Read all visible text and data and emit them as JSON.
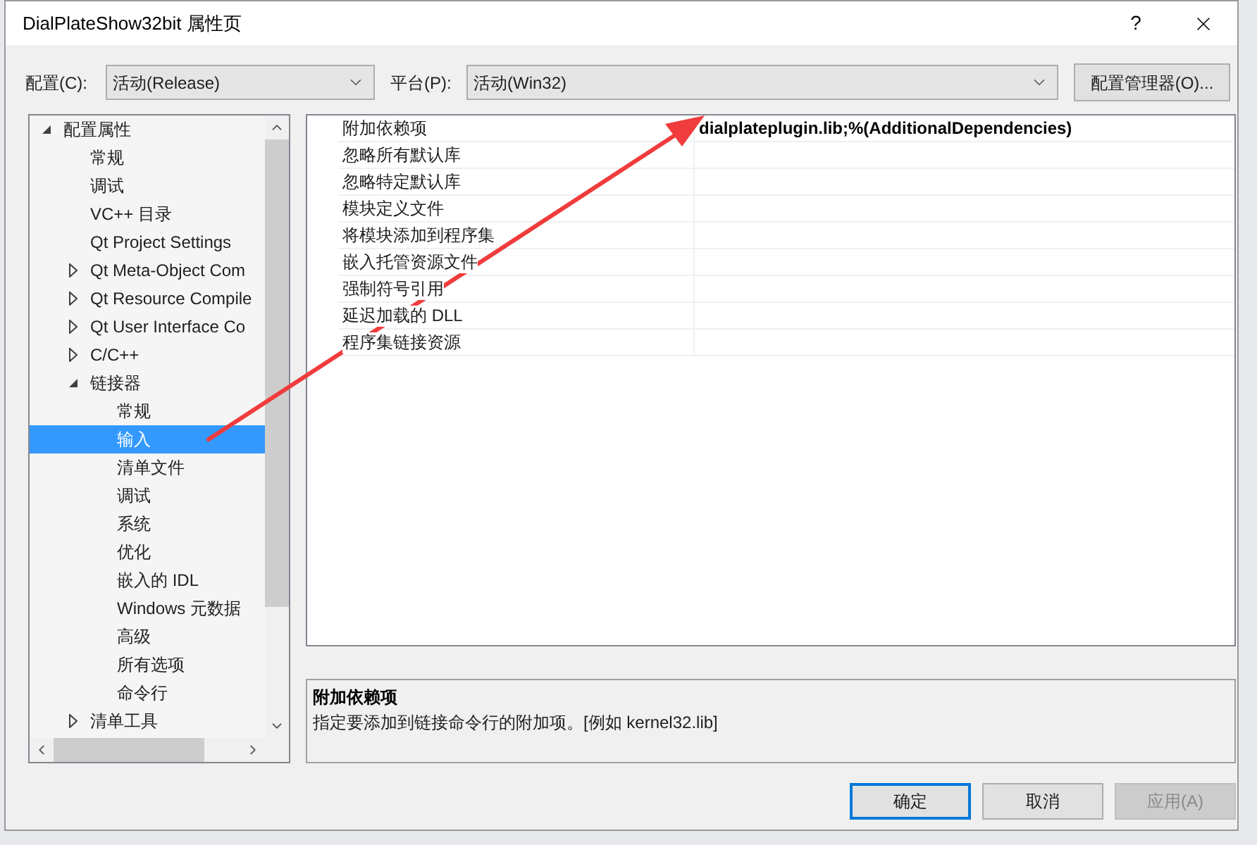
{
  "window": {
    "title": "DialPlateShow32bit 属性页",
    "help": "?"
  },
  "toolbar": {
    "configuration": {
      "label": "配置(C):",
      "value": "活动(Release)"
    },
    "platform": {
      "label": "平台(P):",
      "value": "活动(Win32)"
    },
    "manager_button": "配置管理器(O)..."
  },
  "tree": {
    "items": [
      {
        "label": "配置属性",
        "expanded": true,
        "selected": false,
        "children": [
          {
            "label": "常规",
            "selected": false
          },
          {
            "label": "调试",
            "selected": false
          },
          {
            "label": "VC++ 目录",
            "selected": false
          },
          {
            "label": "Qt Project Settings",
            "selected": false
          },
          {
            "label": "Qt Meta-Object Com",
            "expanded": false,
            "selected": false
          },
          {
            "label": "Qt Resource Compile",
            "expanded": false,
            "selected": false
          },
          {
            "label": "Qt User Interface Co",
            "expanded": false,
            "selected": false
          },
          {
            "label": "C/C++",
            "expanded": false,
            "selected": false
          },
          {
            "label": "链接器",
            "expanded": true,
            "selected": false,
            "children": [
              {
                "label": "常规",
                "selected": false
              },
              {
                "label": "输入",
                "selected": true
              },
              {
                "label": "清单文件",
                "selected": false
              },
              {
                "label": "调试",
                "selected": false
              },
              {
                "label": "系统",
                "selected": false
              },
              {
                "label": "优化",
                "selected": false
              },
              {
                "label": "嵌入的 IDL",
                "selected": false
              },
              {
                "label": "Windows 元数据",
                "selected": false
              },
              {
                "label": "高级",
                "selected": false
              },
              {
                "label": "所有选项",
                "selected": false
              },
              {
                "label": "命令行",
                "selected": false
              }
            ]
          },
          {
            "label": "清单工具",
            "expanded": false,
            "selected": false
          }
        ]
      }
    ]
  },
  "properties": {
    "rows": [
      {
        "name": "附加依赖项",
        "value": "dialplateplugin.lib;%(AdditionalDependencies)"
      },
      {
        "name": "忽略所有默认库"
      },
      {
        "name": "忽略特定默认库"
      },
      {
        "name": "模块定义文件"
      },
      {
        "name": "将模块添加到程序集"
      },
      {
        "name": "嵌入托管资源文件"
      },
      {
        "name": "强制符号引用"
      },
      {
        "name": "延迟加载的 DLL"
      },
      {
        "name": "程序集链接资源"
      }
    ]
  },
  "description": {
    "title": "附加依赖项",
    "text": "指定要添加到链接命令行的附加项。[例如 kernel32.lib]"
  },
  "buttons": [
    {
      "label": "确定",
      "default": true,
      "disabled": false
    },
    {
      "label": "取消",
      "default": false,
      "disabled": false
    },
    {
      "label": "应用(A)",
      "default": false,
      "disabled": true
    }
  ]
}
